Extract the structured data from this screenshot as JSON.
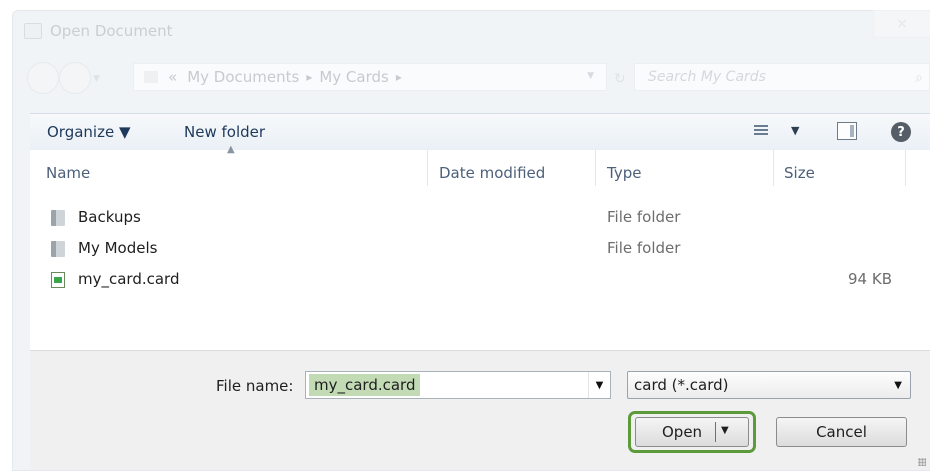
{
  "window": {
    "title": "Open Document",
    "close_glyph": "×"
  },
  "address": {
    "overflow": "«",
    "crumbs": [
      "My Documents",
      "My Cards"
    ],
    "search_placeholder": "Search My Cards"
  },
  "toolbar": {
    "organize": "Organize ▼",
    "new_folder": "New folder",
    "view_dropdown": "▼",
    "help": "?"
  },
  "columns": {
    "name": "Name",
    "date": "Date modified",
    "type": "Type",
    "size": "Size"
  },
  "files": [
    {
      "name": "Backups",
      "type": "File folder",
      "size": "",
      "icon": "folder-icon"
    },
    {
      "name": "My Models",
      "type": "File folder",
      "size": "",
      "icon": "folder-icon"
    },
    {
      "name": "my_card.card",
      "type": "",
      "size": "94 KB",
      "icon": "card-file-icon"
    }
  ],
  "filename": {
    "label": "File name:",
    "value": "my_card.card"
  },
  "filetype": {
    "selected": "card (*.card)"
  },
  "buttons": {
    "open": "Open",
    "cancel": "Cancel"
  },
  "colors": {
    "accent_green": "#5d9a3a",
    "selection_green": "#c3dbb5"
  }
}
